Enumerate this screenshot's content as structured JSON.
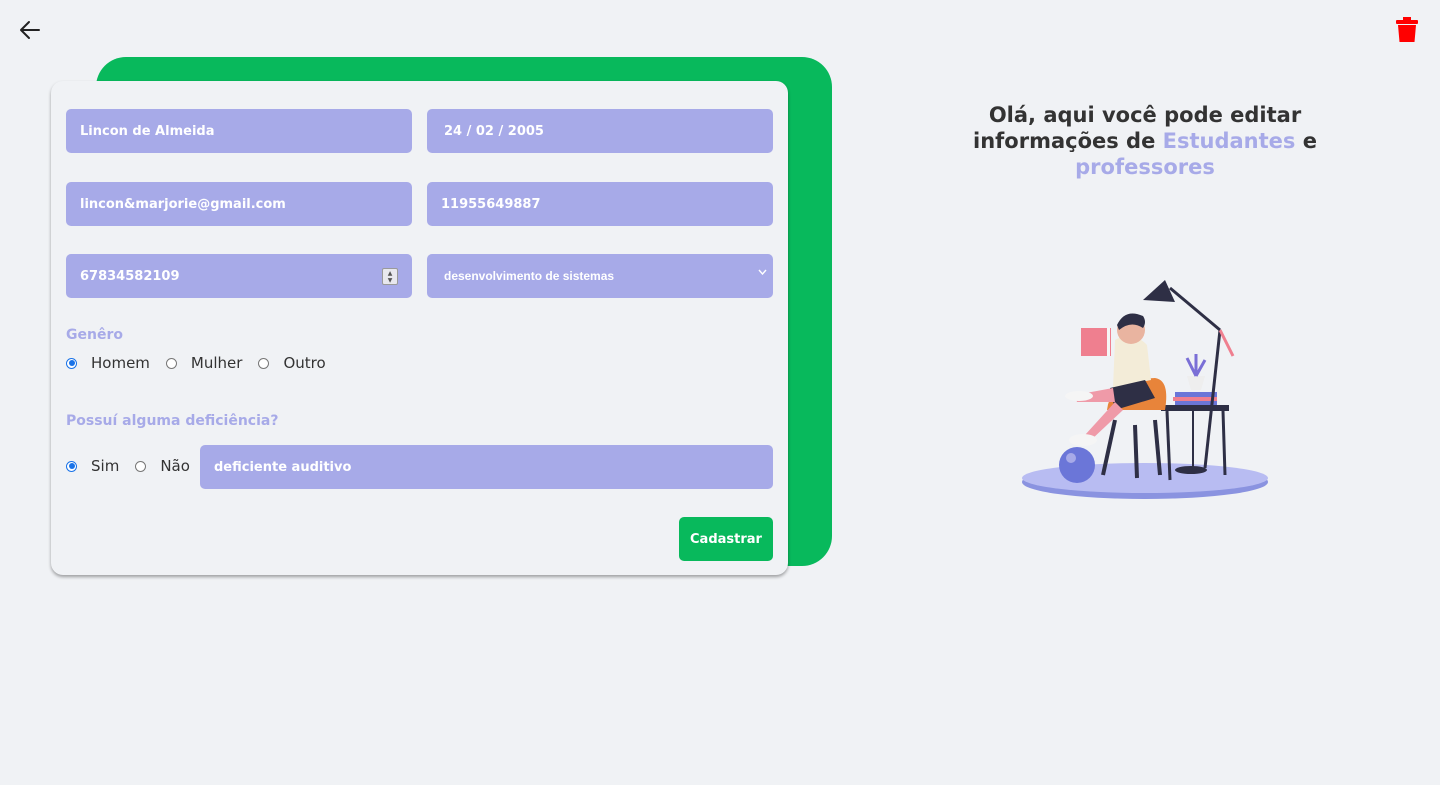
{
  "header": {
    "back_icon": "arrow-left-icon",
    "delete_icon": "trash-icon"
  },
  "form": {
    "name": "Lincon de Almeida",
    "birthdate": "24 / 02 / 2005",
    "email": "lincon&marjorie@gmail.com",
    "phone": "11955649887",
    "cpf": "67834582109",
    "course": "desenvolvimento de sistemas",
    "gender_label": "Genêro",
    "gender_options": [
      "Homem",
      "Mulher",
      "Outro"
    ],
    "gender_selected": "Homem",
    "disability_label": "Possuí alguma deficiência?",
    "disability_options": [
      "Sim",
      "Não"
    ],
    "disability_selected": "Sim",
    "disability_value": "deficiente auditivo",
    "submit_label": "Cadastrar"
  },
  "intro": {
    "line1": "Olá, aqui você pode editar",
    "line2_pre": "informações de ",
    "line2_highlight": "Estudantes",
    "line2_post": " e",
    "line3_highlight": "professores"
  },
  "colors": {
    "accent": "#08b95c",
    "field": "#a7aae8",
    "delete": "#ff0000",
    "background": "#f0f2f5"
  }
}
